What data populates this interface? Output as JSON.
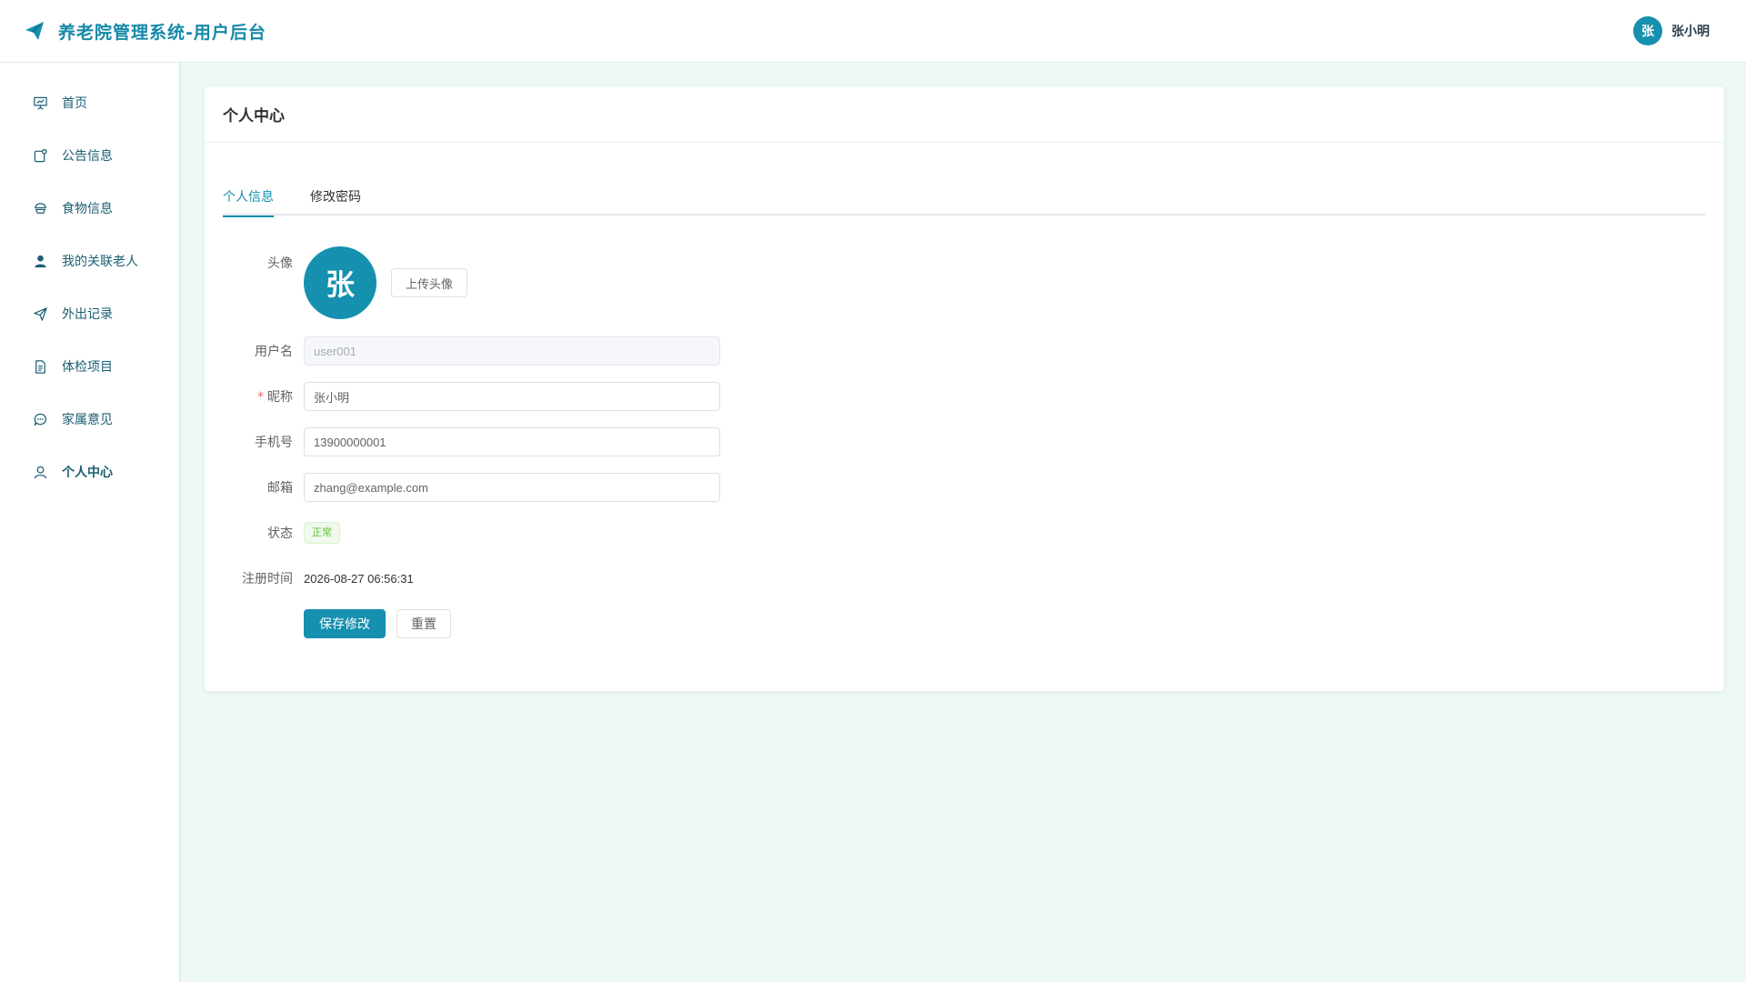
{
  "app": {
    "title": "养老院管理系统-用户后台",
    "brand_icon": "paper-plane-icon",
    "accent_color": "#1590ae"
  },
  "header": {
    "user": {
      "avatar_char": "张",
      "name": "张小明"
    }
  },
  "sidebar": {
    "items": [
      {
        "label": "首页",
        "icon": "dashboard-icon",
        "active": false
      },
      {
        "label": "公告信息",
        "icon": "notice-icon",
        "active": false
      },
      {
        "label": "食物信息",
        "icon": "food-icon",
        "active": false
      },
      {
        "label": "我的关联老人",
        "icon": "user-filled-icon",
        "active": false
      },
      {
        "label": "外出记录",
        "icon": "send-icon",
        "active": false
      },
      {
        "label": "体检项目",
        "icon": "document-icon",
        "active": false
      },
      {
        "label": "家属意见",
        "icon": "chat-icon",
        "active": false
      },
      {
        "label": "个人中心",
        "icon": "user-icon",
        "active": true
      }
    ]
  },
  "page": {
    "title": "个人中心",
    "tabs": [
      {
        "label": "个人信息",
        "active": true
      },
      {
        "label": "修改密码",
        "active": false
      }
    ]
  },
  "form": {
    "avatar": {
      "label": "头像",
      "char": "张",
      "upload_label": "上传头像"
    },
    "username": {
      "label": "用户名",
      "value": "user001"
    },
    "nickname": {
      "label": "昵称",
      "required_mark": "*",
      "value": "张小明"
    },
    "phone": {
      "label": "手机号",
      "value": "13900000001"
    },
    "email": {
      "label": "邮箱",
      "value": "zhang@example.com"
    },
    "status": {
      "label": "状态",
      "value": "正常",
      "color": "#67c23a"
    },
    "register_time": {
      "label": "注册时间",
      "value": "2026-08-27 06:56:31"
    },
    "save_label": "保存修改",
    "reset_label": "重置"
  }
}
